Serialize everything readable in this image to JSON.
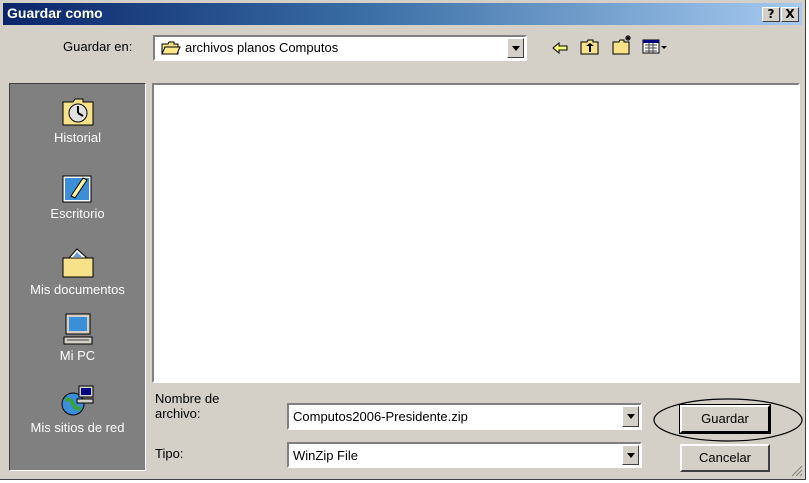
{
  "title": "Guardar como",
  "title_buttons": {
    "help": "?",
    "close": "X"
  },
  "save_in": {
    "label": "Guardar en:",
    "folder": "archivos planos Computos"
  },
  "toolbar_icons": [
    "back-arrow-icon",
    "up-folder-icon",
    "new-folder-icon",
    "view-menu-icon"
  ],
  "places": [
    {
      "label": "Historial",
      "icon": "history-icon"
    },
    {
      "label": "Escritorio",
      "icon": "desktop-icon"
    },
    {
      "label": "Mis documentos",
      "icon": "my-documents-icon"
    },
    {
      "label": "Mi PC",
      "icon": "my-computer-icon"
    },
    {
      "label": "Mis sitios de red",
      "icon": "network-places-icon"
    }
  ],
  "filename": {
    "label": "Nombre de archivo:",
    "value": "Computos2006-Presidente.zip"
  },
  "filetype": {
    "label": "Tipo:",
    "value": "WinZip File"
  },
  "buttons": {
    "save": "Guardar",
    "cancel": "Cancelar"
  },
  "colors": {
    "title_start": "#0a246a",
    "title_end": "#a6caf0",
    "face": "#d4d0c8",
    "places_bg": "#808080"
  }
}
